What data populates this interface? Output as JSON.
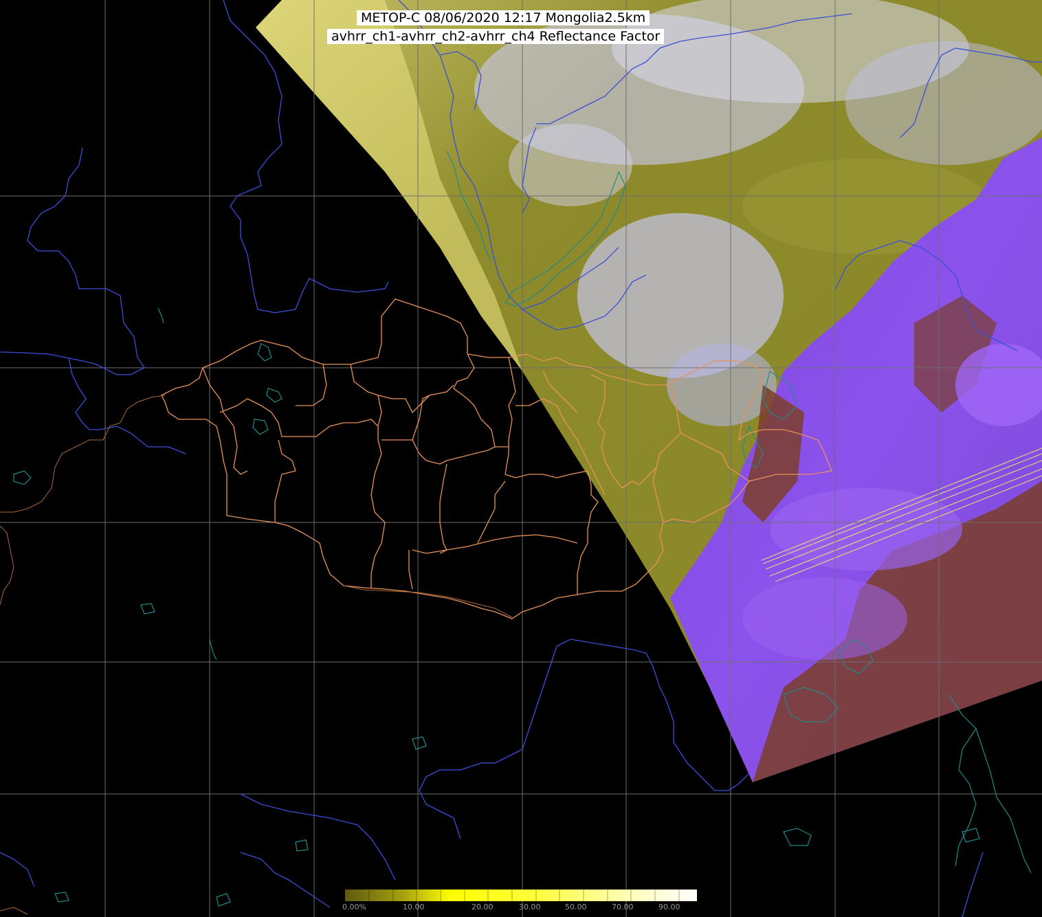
{
  "title": {
    "line1": "METOP-C 08/06/2020 12:17 Mongolia2.5km",
    "line2": "avhrr_ch1-avhrr_ch2-avhrr_ch4 Reflectance Factor"
  },
  "colorbar": {
    "labels": [
      "0.00%",
      "10.00",
      "20.00",
      "30.00",
      "50.00",
      "70.00",
      "90.00"
    ],
    "colors": [
      "#5e5a10",
      "#8f8a14",
      "#cfcf10",
      "#ffff00",
      "#ffff60",
      "#ffffb0",
      "#ffffff"
    ]
  },
  "colors": {
    "background": "#000000",
    "grid": "#6e6e6e",
    "rivers": "#3a4fd8",
    "coast": "#1f8a8a",
    "admin_borders": "#e8935a",
    "swath_olive": "#8c8a2a",
    "swath_yellow": "#e8e088",
    "swath_cloud": "#b8b8f0",
    "swath_purple": "#8a4de8",
    "swath_brown": "#7a3d28"
  }
}
